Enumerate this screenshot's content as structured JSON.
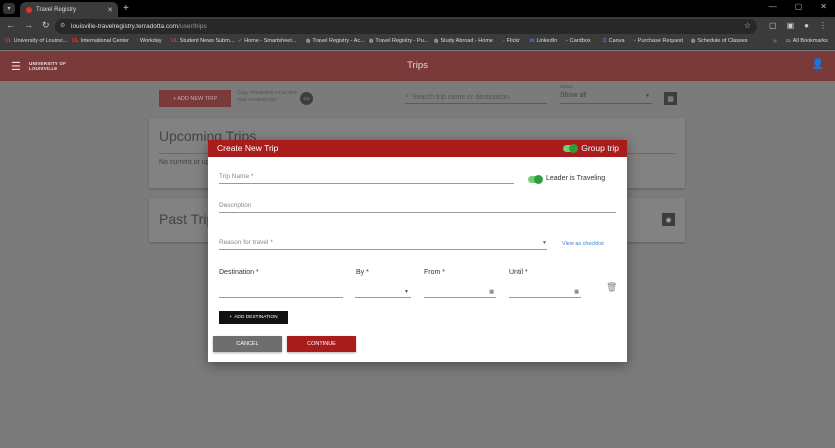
{
  "browser": {
    "tab_title": "Travel Registry",
    "new_tab": "+",
    "url_host": "louisville-travelregistry.terradotta.com",
    "url_path": "/user/trips",
    "bookmarks": [
      {
        "icon": "UL",
        "label": "University of Louisvi..."
      },
      {
        "icon": "UL",
        "label": "International Center"
      },
      {
        "icon": "◌",
        "label": "Workday"
      },
      {
        "icon": "UL",
        "label": "Student News Subm..."
      },
      {
        "icon": "✓",
        "label": "Home - Smartsheet..."
      },
      {
        "icon": "◍",
        "label": "Travel Registry - Ac..."
      },
      {
        "icon": "◍",
        "label": "Travel Registry - Pu..."
      },
      {
        "icon": "◍",
        "label": "Study Abroad - Home"
      },
      {
        "icon": "▪",
        "label": "Flickr"
      },
      {
        "icon": "in",
        "label": "LinkedIn"
      },
      {
        "icon": "▪",
        "label": "Cardbox"
      },
      {
        "icon": "C",
        "label": "Canva"
      },
      {
        "icon": "▪",
        "label": "Purchase Request"
      },
      {
        "icon": "◍",
        "label": "Schedule of Classes"
      }
    ],
    "all_bookmarks": "All Bookmarks"
  },
  "app": {
    "logo_line1": "UNIVERSITY OF",
    "logo_line2": "LOUISVILLE",
    "page_title": "Trips",
    "accent": "#a81c1c"
  },
  "toolbar": {
    "new_trip": "+ ADD NEW TRIP",
    "forward_text": "Copy forwarding email and start creating trips",
    "forward_btn": "CO",
    "search_placeholder": "Search trip name or destination",
    "status_label": "Status",
    "status_value": "Show all"
  },
  "sections": {
    "upcoming_title": "Upcoming Trips",
    "upcoming_empty": "No current or up",
    "past_title": "Past Trip"
  },
  "modal": {
    "title": "Create New Trip",
    "group_trip": "Group trip",
    "trip_name_placeholder": "Trip Name *",
    "leader_traveling": "Leader is Traveling",
    "description_placeholder": "Description",
    "reason_placeholder": "Reason for travel *",
    "view_checklist": "View as checklist",
    "destination_label": "Destination *",
    "by_label": "By *",
    "from_label": "From *",
    "until_label": "Until *",
    "add_destination": "ADD DESTINATION",
    "cancel": "CANCEL",
    "continue": "CONTINUE"
  }
}
